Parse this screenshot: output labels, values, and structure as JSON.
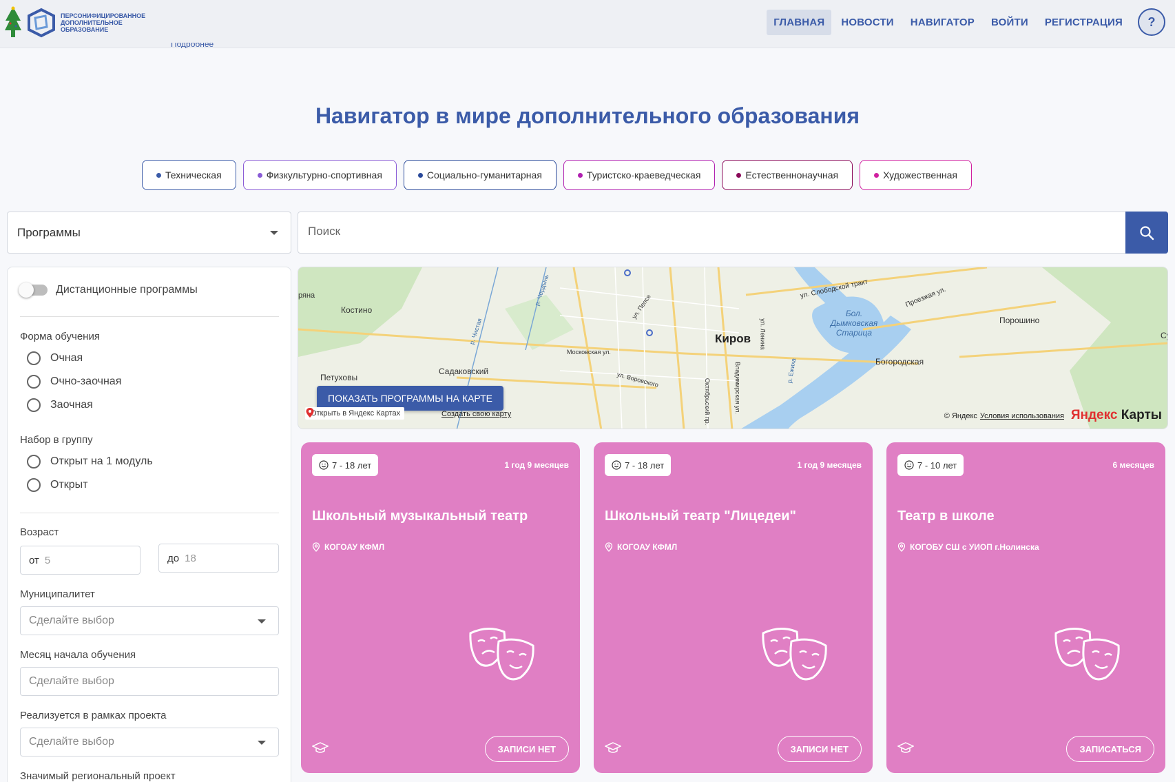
{
  "header": {
    "logo_text": "ПЕРСОНИФИЦИРОВАННОЕ ДОПОЛНИТЕЛЬНОЕ ОБРАЗОВАНИЕ",
    "nav": [
      {
        "label": "ГЛАВНАЯ",
        "active": true
      },
      {
        "label": "НОВОСТИ",
        "active": false
      },
      {
        "label": "НАВИГАТОР",
        "active": false
      },
      {
        "label": "ВОЙТИ",
        "active": false
      },
      {
        "label": "РЕГИСТРАЦИЯ",
        "active": false
      }
    ],
    "help_label": "?",
    "ghost_text": "Подробнее"
  },
  "page_title": "Навигатор в мире дополнительного образования",
  "directions": [
    {
      "label": "Техническая",
      "color": "#3b5ba8"
    },
    {
      "label": "Физкультурно-спортивная",
      "color": "#8a5cd6"
    },
    {
      "label": "Социально-гуманитарная",
      "color": "#2a4a9a"
    },
    {
      "label": "Туристско-краеведческая",
      "color": "#b020b0"
    },
    {
      "label": "Естественнонаучная",
      "color": "#8a0a5a"
    },
    {
      "label": "Художественная",
      "color": "#d020a0"
    }
  ],
  "search": {
    "type_selected": "Программы",
    "placeholder": "Поиск"
  },
  "filters": {
    "remote_label": "Дистанционные программы",
    "form_label": "Форма обучения",
    "form_options": [
      "Очная",
      "Очно-заочная",
      "Заочная"
    ],
    "group_label": "Набор в группу",
    "group_options": [
      "Открыт на 1 модуль",
      "Открыт"
    ],
    "age_label": "Возраст",
    "age_from_prefix": "от",
    "age_from_placeholder": "5",
    "age_to_prefix": "до",
    "age_to_placeholder": "18",
    "municipality_label": "Муниципалитет",
    "municipality_placeholder": "Сделайте выбор",
    "month_label": "Месяц начала обучения",
    "month_placeholder": "Сделайте выбор",
    "project_label": "Реализуется в рамках проекта",
    "project_placeholder": "Сделайте выбор",
    "regional_label": "Значимый региональный проект"
  },
  "map": {
    "labels": [
      "ряна",
      "Костино",
      "Петуховы",
      "Садаковский",
      "Богородская",
      "Порошино",
      "Бол. Дымковская Старица",
      "ул. Слободской тракт",
      "Проезжая ул.",
      "Московская ул.",
      "ул. Воровского",
      "ул. Ленина",
      "ул. Пепсе",
      "р. Чистая",
      "Октябрьский пр.",
      "Владимирская ул.",
      "р. Чердынь",
      "Су",
      "р. Ежиха"
    ],
    "city": "Киров",
    "show_button": "ПОКАЗАТЬ ПРОГРАММЫ НА КАРТЕ",
    "open_link": "Открыть в Яндекс Картах",
    "create_link": "Создать свою карту",
    "copyright": "© Яндекс",
    "terms": "Условия использования",
    "brand_ya": "Яндекс",
    "brand_rest": " Карты"
  },
  "cards": [
    {
      "age": "7 - 18 лет",
      "duration": "1 год 9 месяцев",
      "title": "Школьный музыкальный театр",
      "org": "КОГОАУ КФМЛ",
      "button": "ЗАПИСИ НЕТ",
      "color": "#e07fc4"
    },
    {
      "age": "7 - 18 лет",
      "duration": "1 год 9 месяцев",
      "title": "Школьный театр \"Лицедеи\"",
      "org": "КОГОАУ КФМЛ",
      "button": "ЗАПИСИ НЕТ",
      "color": "#e07fc4"
    },
    {
      "age": "7 - 10 лет",
      "duration": "6 месяцев",
      "title": "Театр в школе",
      "org": "КОГОБУ СШ с УИОП г.Нолинска",
      "button": "ЗАПИСАТЬСЯ",
      "color": "#e07fc4"
    }
  ]
}
